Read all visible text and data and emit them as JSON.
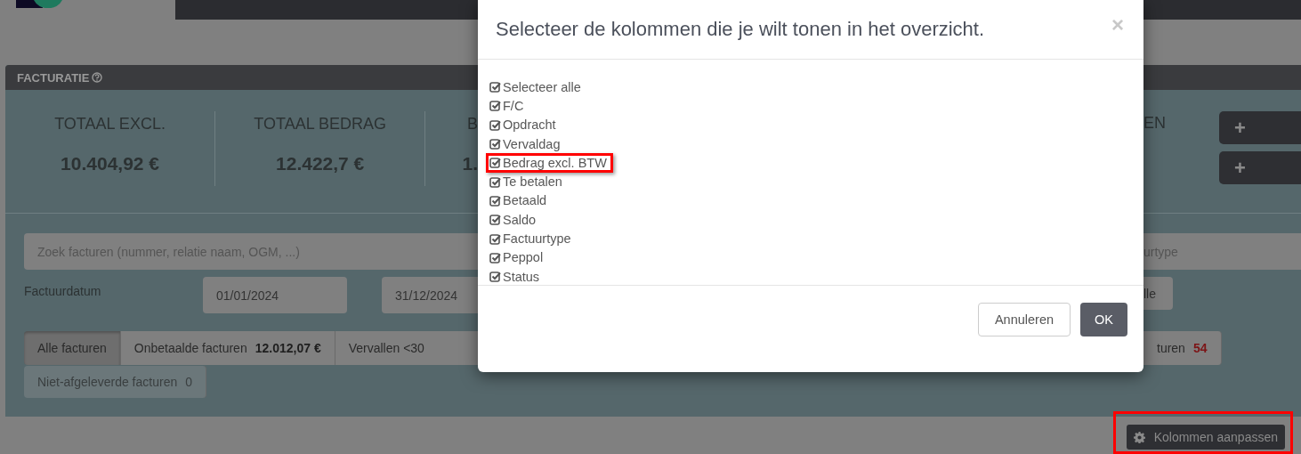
{
  "panel": {
    "title": "FACTURATIE",
    "stats": [
      {
        "label": "TOTAAL EXCL.",
        "value": "10.404,92 €"
      },
      {
        "label": "TOTAAL BEDRAG",
        "value": "12.422,7 €"
      },
      {
        "label": "B",
        "value": "1."
      }
    ],
    "stat_right": {
      "label": "EN"
    },
    "add_buttons": [
      "+",
      "+"
    ],
    "search": {
      "placeholder": "Zoek facturen (nummer, relatie naam, OGM, ...)"
    },
    "type_filter": {
      "placeholder": "urtype"
    },
    "date_label": "Factuurdatum",
    "date_from": "01/01/2024",
    "date_to": "31/12/2024",
    "right_button": "lle",
    "filters": [
      {
        "label": "Alle facturen",
        "selected": true
      },
      {
        "label": "Onbetaalde facturen",
        "amount": "12.012,07 €",
        "selected": false
      },
      {
        "label": "Vervallen <30",
        "selected": false
      }
    ],
    "filters_right": [
      {
        "label": "turen",
        "count": "54",
        "alert": true,
        "selected": false
      }
    ],
    "filters_row2": [
      {
        "label": "Niet-afgeleverde facturen",
        "count": "0",
        "alert": false,
        "selected": false
      }
    ]
  },
  "columns_button": {
    "label": "Kolommen aanpassen",
    "highlighted": true
  },
  "dialog": {
    "title": "Selecteer de kolommen die je wilt tonen in het overzicht.",
    "close": "×",
    "columns": [
      {
        "label": "Selecteer alle",
        "checked": true,
        "highlighted": false
      },
      {
        "label": "F/C",
        "checked": true,
        "highlighted": false
      },
      {
        "label": "Opdracht",
        "checked": true,
        "highlighted": false
      },
      {
        "label": "Vervaldag",
        "checked": true,
        "highlighted": false
      },
      {
        "label": "Bedrag excl. BTW",
        "checked": true,
        "highlighted": true
      },
      {
        "label": "Te betalen",
        "checked": true,
        "highlighted": false
      },
      {
        "label": "Betaald",
        "checked": true,
        "highlighted": false
      },
      {
        "label": "Saldo",
        "checked": true,
        "highlighted": false
      },
      {
        "label": "Factuurtype",
        "checked": true,
        "highlighted": false
      },
      {
        "label": "Peppol",
        "checked": true,
        "highlighted": false
      },
      {
        "label": "Status",
        "checked": true,
        "highlighted": false
      }
    ],
    "buttons": [
      {
        "label": "Annuleren",
        "kind": "secondary"
      },
      {
        "label": "OK",
        "kind": "primary"
      }
    ]
  }
}
